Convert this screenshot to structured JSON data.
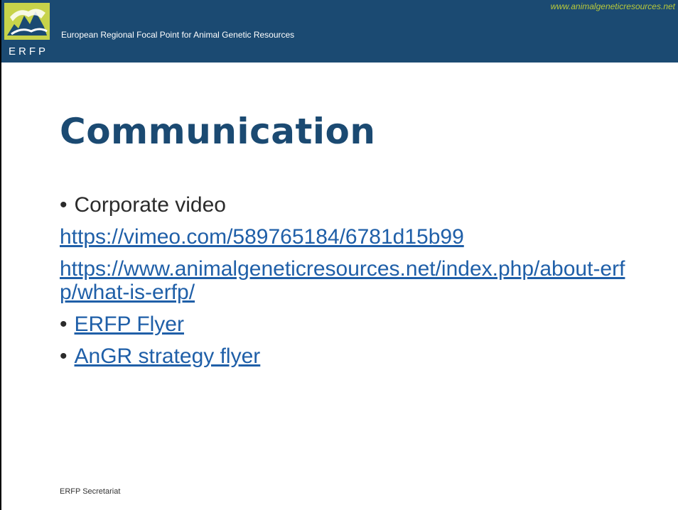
{
  "header": {
    "org_name": "European Regional Focal Point for Animal Genetic Resources",
    "url": "www.animalgeneticresources.net",
    "logo_text": "ERFP"
  },
  "slide": {
    "title": "Communication",
    "items": [
      {
        "type": "bullet",
        "text": "Corporate video"
      },
      {
        "type": "link",
        "text": "https://vimeo.com/589765184/6781d15b99"
      },
      {
        "type": "link",
        "text": "https://www.animalgeneticresources.net/index.php/about-erfp/what-is-erfp/"
      },
      {
        "type": "bullet-link",
        "text": "ERFP Flyer"
      },
      {
        "type": "bullet-link",
        "text": "AnGR strategy flyer"
      }
    ]
  },
  "footer": {
    "text": "ERFP Secretariat"
  },
  "colors": {
    "header_bg": "#1b4a72",
    "title": "#1b4a72",
    "accent": "#b9c93a",
    "link": "#1f5fa8"
  },
  "icons": [
    "erfp-logo-icon"
  ]
}
